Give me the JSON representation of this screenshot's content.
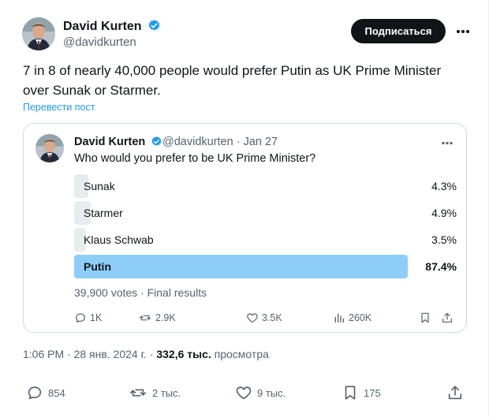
{
  "author": {
    "name": "David Kurten",
    "handle": "@davidkurten",
    "verified_icon": "verified-badge-icon"
  },
  "header": {
    "subscribe_label": "Подписаться"
  },
  "tweet": {
    "text": "7 in 8 of nearly 40,000 people would prefer Putin as UK Prime Minister over Sunak or Starmer.",
    "translate_label": "Перевести пост"
  },
  "quote": {
    "author_name": "David Kurten",
    "handle_date": "@davidkurten · Jan 27",
    "question": "Who would you prefer to be UK Prime Minister?",
    "poll": {
      "options": [
        {
          "label": "Sunak",
          "percent_text": "4.3%",
          "percent": 4.3,
          "winner": false
        },
        {
          "label": "Starmer",
          "percent_text": "4.9%",
          "percent": 4.9,
          "winner": false
        },
        {
          "label": "Klaus Schwab",
          "percent_text": "3.5%",
          "percent": 3.5,
          "winner": false
        },
        {
          "label": "Putin",
          "percent_text": "87.4%",
          "percent": 87.4,
          "winner": true
        }
      ],
      "summary": "39,900 votes · Final results"
    },
    "actions": {
      "replies": "1K",
      "reposts": "2.9K",
      "likes": "3.5K",
      "views": "260K"
    }
  },
  "meta": {
    "time_date": "1:06 PM · 28 янв. 2024 г. · ",
    "views_count": "332,6 тыс.",
    "views_label": " просмотра"
  },
  "actions": {
    "replies": "854",
    "reposts": "2 тыс.",
    "likes": "9 тыс.",
    "bookmarks": "175"
  },
  "colors": {
    "accent": "#1d9bf0",
    "winner_bar": "#8ecdf8",
    "bar": "#e6ecf0",
    "text": "#0f1419",
    "muted": "#536471"
  }
}
